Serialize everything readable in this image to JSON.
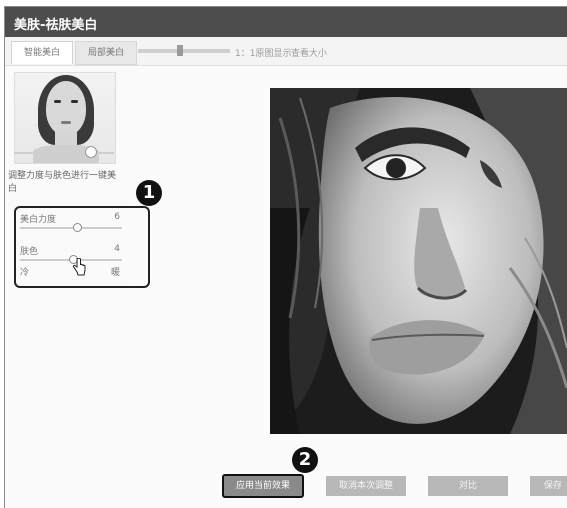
{
  "window": {
    "title": "美肤-祛肤美白"
  },
  "tabs": [
    {
      "label": "智能美白"
    },
    {
      "label": "局部美白"
    }
  ],
  "toolbar": {
    "tool1": "1：1原图显示",
    "tool2": "查看大小"
  },
  "left_panel": {
    "description": "调整力度与肤色进行一键美白",
    "sliders": [
      {
        "label": "美白力度",
        "value": "6"
      },
      {
        "label": "肤色",
        "value": "4",
        "min_label": "冷",
        "max_label": "暖"
      }
    ]
  },
  "annotations": {
    "badge1": "1",
    "badge2": "2"
  },
  "buttons": {
    "apply": "应用当前效果",
    "cancel": "取消本次调整",
    "compare": "对比",
    "save": "保存"
  }
}
